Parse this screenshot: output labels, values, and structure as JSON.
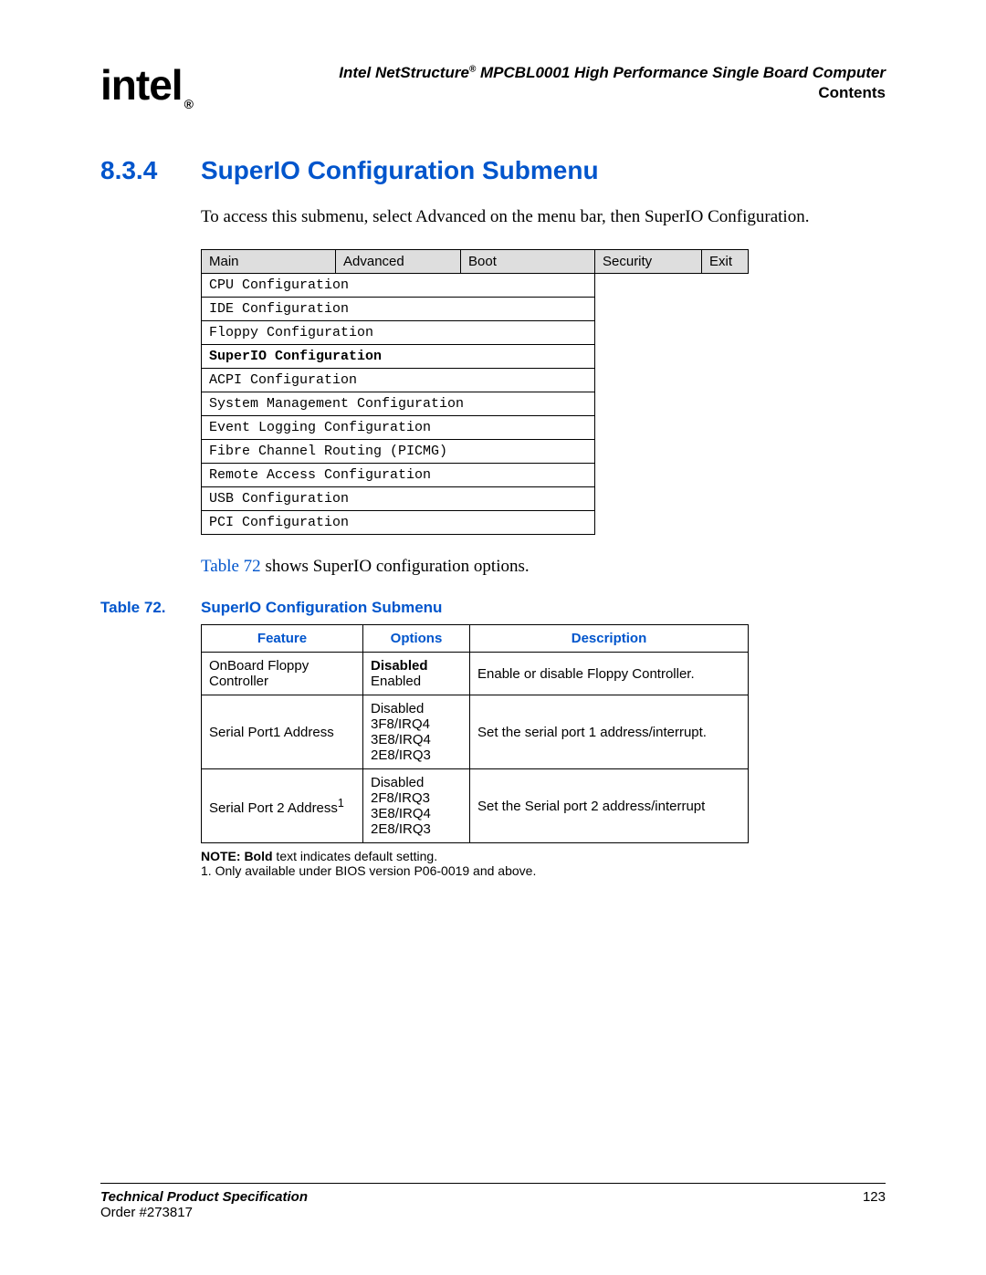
{
  "header": {
    "logo_text": "intel",
    "logo_reg": "®",
    "doc_title_prefix": "Intel NetStructure",
    "doc_title_reg": "®",
    "doc_title_suffix": " MPCBL0001 High Performance Single Board Computer",
    "doc_section": "Contents"
  },
  "section": {
    "number": "8.3.4",
    "title": "SuperIO Configuration Submenu"
  },
  "intro_text": "To access this submenu, select Advanced on the menu bar, then SuperIO Configuration.",
  "menu": {
    "tabs": [
      "Main",
      "Advanced",
      "Boot",
      "Security",
      "Exit"
    ],
    "items": [
      "CPU Configuration",
      "IDE Configuration",
      "Floppy Configuration",
      "SuperIO Configuration",
      "ACPI Configuration",
      "System Management Configuration",
      "Event Logging Configuration",
      "Fibre Channel Routing (PICMG)",
      "Remote Access Configuration",
      "USB Configuration",
      "PCI Configuration"
    ],
    "selected_index": 3
  },
  "reference": {
    "link_text": "Table 72",
    "rest_text": " shows SuperIO configuration options."
  },
  "table_caption": {
    "prefix": "Table 72.",
    "title": "SuperIO Configuration Submenu"
  },
  "opt_table": {
    "headers": [
      "Feature",
      "Options",
      "Description"
    ],
    "rows": [
      {
        "feature": "OnBoard Floppy Controller",
        "feature_sup": "",
        "options": [
          "Disabled",
          "Enabled"
        ],
        "default_index": 0,
        "description": "Enable or disable Floppy Controller."
      },
      {
        "feature": "Serial Port1 Address",
        "feature_sup": "",
        "options": [
          "Disabled",
          "3F8/IRQ4",
          "3E8/IRQ4",
          "2E8/IRQ3"
        ],
        "default_index": -1,
        "description": "Set the serial port 1 address/interrupt."
      },
      {
        "feature": "Serial Port 2 Address",
        "feature_sup": "1",
        "options": [
          "Disabled",
          "2F8/IRQ3",
          "3E8/IRQ4",
          "2E8/IRQ3"
        ],
        "default_index": -1,
        "description": "Set the Serial port 2 address/interrupt"
      }
    ]
  },
  "notes": {
    "note_label": "NOTE:  Bold",
    "note_text": " text indicates default setting.",
    "footnote_1": "1. Only available under BIOS version P06-0019 and above."
  },
  "footer": {
    "tps": "Technical Product Specification",
    "order": "Order #273817",
    "page": "123"
  }
}
